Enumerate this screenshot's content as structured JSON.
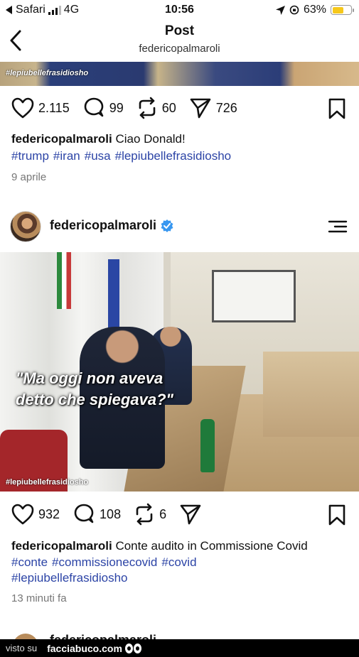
{
  "status_bar": {
    "carrier": "Safari",
    "network": "4G",
    "time": "10:56",
    "battery": "63%",
    "battery_level": 0.63
  },
  "header": {
    "title": "Post",
    "subtitle": "federicopalmaroli"
  },
  "post1": {
    "image_tag": "#lepiubellefrasidiosho",
    "likes": "2.115",
    "comments": "99",
    "reposts": "60",
    "shares": "726",
    "username": "federicopalmaroli",
    "caption": "Ciao Donald!",
    "hashtags": [
      "#trump",
      "#iran",
      "#usa",
      "#lepiubellefrasidiosho"
    ],
    "date": "9 aprile"
  },
  "post2": {
    "username": "federicopalmaroli",
    "image_quote_line1": "\"Ma oggi non aveva",
    "image_quote_line2": "detto che spiegava?\"",
    "image_tag": "#lepiubellefrasidiosho",
    "likes": "932",
    "comments": "108",
    "reposts": "6",
    "caption": "Conte audito in Commissione Covid",
    "hashtags_line1": [
      "#conte",
      "#commissionecovid",
      "#covid"
    ],
    "hashtags_line2": [
      "#lepiubellefrasidiosho"
    ],
    "date": "13 minuti fa"
  },
  "post3": {
    "username": "federicopalmaroli"
  },
  "footer": {
    "visto": "visto su",
    "site": "facciabuco.com"
  },
  "colors": {
    "hashtag": "#2c44a6",
    "verified": "#3897f0",
    "battery": "#f6c81b"
  }
}
